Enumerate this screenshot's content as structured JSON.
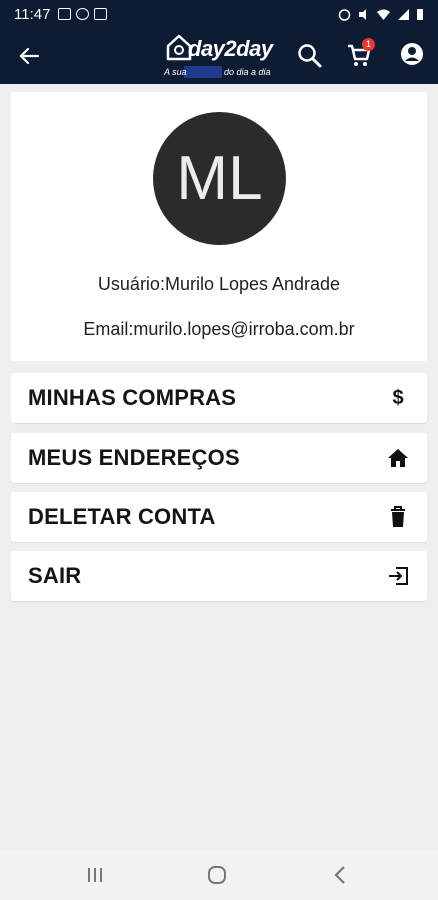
{
  "status_bar": {
    "time": "11:47"
  },
  "header": {
    "brand": "day2day",
    "tagline_start": "A sua",
    "tagline_end": "do dia a dia",
    "cart_count": "1"
  },
  "profile": {
    "initials": "ML",
    "name_line": "Usuário:Murilo Lopes Andrade",
    "email_line": "Email:murilo.lopes@irroba.com.br"
  },
  "menu": [
    {
      "label": "MINHAS COMPRAS",
      "icon": "dollar-icon"
    },
    {
      "label": "MEUS ENDEREÇOS",
      "icon": "home-icon"
    },
    {
      "label": "DELETAR CONTA",
      "icon": "trash-icon"
    },
    {
      "label": "SAIR",
      "icon": "exit-icon"
    }
  ],
  "colors": {
    "header_bg": "#0d1b33",
    "page_bg": "#efefef",
    "avatar_bg": "#2b2b2b",
    "badge": "#e53935"
  }
}
